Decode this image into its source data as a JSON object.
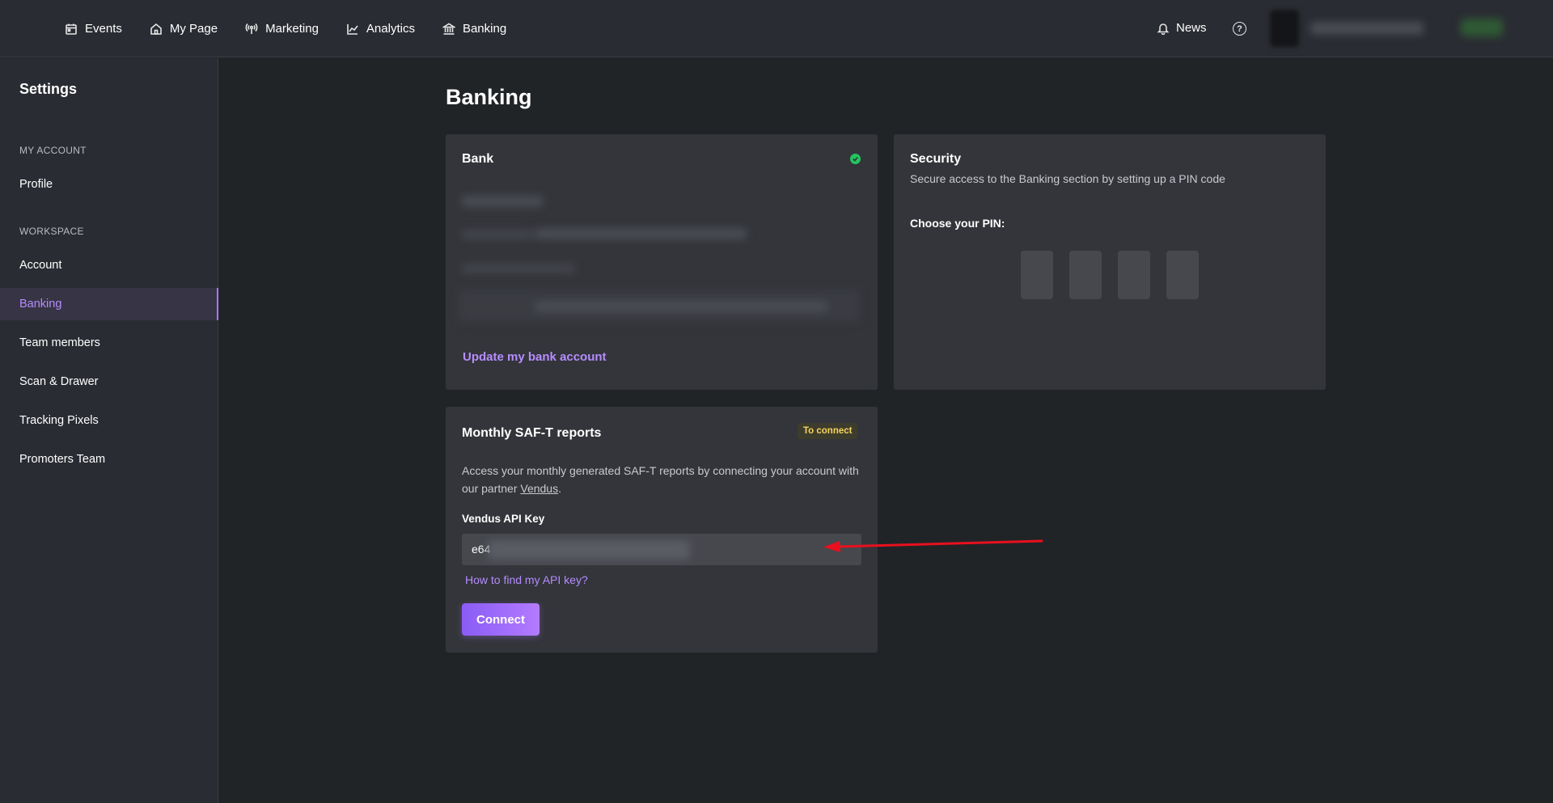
{
  "topnav": {
    "items": [
      {
        "label": "Events",
        "icon": "calendar-icon"
      },
      {
        "label": "My Page",
        "icon": "home-icon"
      },
      {
        "label": "Marketing",
        "icon": "broadcast-icon"
      },
      {
        "label": "Analytics",
        "icon": "chart-line-icon"
      },
      {
        "label": "Banking",
        "icon": "bank-icon"
      }
    ],
    "news_label": "News",
    "help_icon": "question-circle-icon"
  },
  "sidebar": {
    "title": "Settings",
    "sections": [
      {
        "label": "MY ACCOUNT",
        "items": [
          "Profile"
        ]
      },
      {
        "label": "WORKSPACE",
        "items": [
          "Account",
          "Banking",
          "Team members",
          "Scan & Drawer",
          "Tracking Pixels",
          "Promoters Team"
        ]
      }
    ],
    "active_item": "Banking",
    "active_color": "#b68cff"
  },
  "main": {
    "page_title": "Banking",
    "bank_card": {
      "title": "Bank",
      "status_icon": "check-circle-icon",
      "status_color": "#22c55e",
      "update_link": "Update my bank account"
    },
    "security_card": {
      "title": "Security",
      "subtitle": "Secure access to the Banking section by setting up a PIN code",
      "pin_label": "Choose your PIN:"
    },
    "saft_card": {
      "title": "Monthly SAF-T reports",
      "badge": "To connect",
      "description_before": "Access your monthly generated SAF-T reports by connecting your account with our partner ",
      "partner_link": "Vendus",
      "description_after": ".",
      "api_key_label": "Vendus API Key",
      "api_key_prefix": "e64",
      "help_link": "How to find my API key?",
      "connect_button": "Connect"
    }
  }
}
